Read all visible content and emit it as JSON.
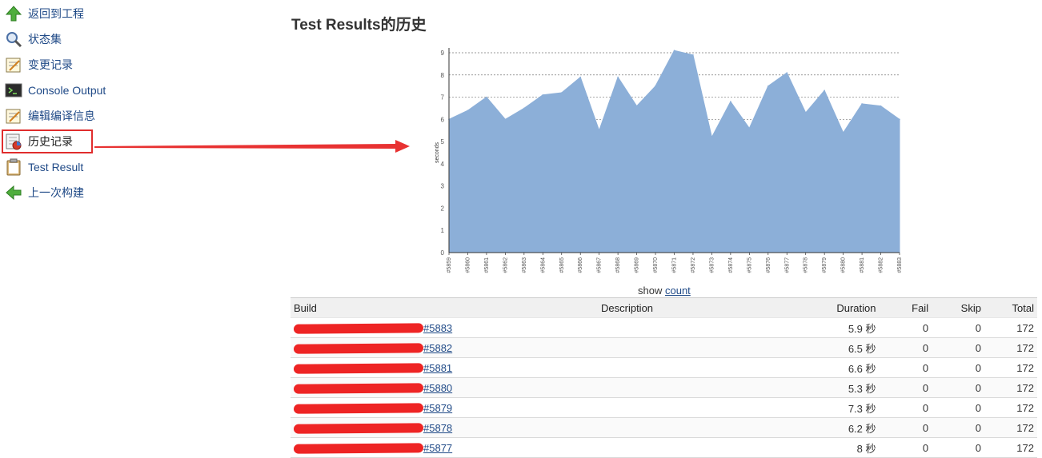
{
  "sidebar": {
    "items": [
      {
        "label": "返回到工程",
        "icon": "up-arrow-icon"
      },
      {
        "label": "状态集",
        "icon": "magnifier-icon"
      },
      {
        "label": "变更记录",
        "icon": "notepad-icon"
      },
      {
        "label": "Console Output",
        "icon": "terminal-icon"
      },
      {
        "label": "编辑编译信息",
        "icon": "notepad-pencil-icon"
      },
      {
        "label": "历史记录",
        "icon": "history-chart-icon"
      },
      {
        "label": "Test Result",
        "icon": "clipboard-icon"
      },
      {
        "label": "上一次构建",
        "icon": "left-arrow-icon"
      }
    ]
  },
  "page": {
    "title": "Test Results的历史"
  },
  "chart_data": {
    "type": "area",
    "x": [
      "#5859",
      "#5860",
      "#5861",
      "#5862",
      "#5863",
      "#5864",
      "#5865",
      "#5866",
      "#5867",
      "#5868",
      "#5869",
      "#5870",
      "#5871",
      "#5872",
      "#5873",
      "#5874",
      "#5875",
      "#5876",
      "#5877",
      "#5878",
      "#5879",
      "#5880",
      "#5881",
      "#5882",
      "#5883"
    ],
    "series": [
      {
        "values": [
          6.0,
          6.4,
          7.0,
          6.0,
          6.5,
          7.1,
          7.2,
          7.9,
          5.5,
          7.9,
          6.6,
          7.5,
          9.1,
          8.9,
          5.2,
          6.8,
          5.6,
          7.5,
          8.1,
          6.3,
          7.3,
          5.4,
          6.7,
          6.6,
          6.0
        ]
      }
    ],
    "ylim": [
      0,
      9
    ],
    "yticks": [
      0,
      1,
      2,
      3,
      4,
      5,
      6,
      7,
      8,
      9
    ],
    "grid": true,
    "color": "#8cafd8",
    "ylabel": "seconds"
  },
  "chart_footer": {
    "prefix": "show",
    "link": "count"
  },
  "table": {
    "headers": {
      "build": "Build",
      "description": "Description",
      "duration": "Duration",
      "fail": "Fail",
      "skip": "Skip",
      "total": "Total"
    },
    "rows": [
      {
        "build": "#5883",
        "description": "",
        "duration": "5.9 秒",
        "fail": "0",
        "skip": "0",
        "total": "172"
      },
      {
        "build": "#5882",
        "description": "",
        "duration": "6.5 秒",
        "fail": "0",
        "skip": "0",
        "total": "172"
      },
      {
        "build": "#5881",
        "description": "",
        "duration": "6.6 秒",
        "fail": "0",
        "skip": "0",
        "total": "172"
      },
      {
        "build": "#5880",
        "description": "",
        "duration": "5.3 秒",
        "fail": "0",
        "skip": "0",
        "total": "172"
      },
      {
        "build": "#5879",
        "description": "",
        "duration": "7.3 秒",
        "fail": "0",
        "skip": "0",
        "total": "172"
      },
      {
        "build": "#5878",
        "description": "",
        "duration": "6.2 秒",
        "fail": "0",
        "skip": "0",
        "total": "172"
      },
      {
        "build": "#5877",
        "description": "",
        "duration": "8 秒",
        "fail": "0",
        "skip": "0",
        "total": "172"
      }
    ]
  },
  "colors": {
    "link": "#204a87",
    "annotation": "#e02d2d",
    "area": "#8cafd8"
  }
}
